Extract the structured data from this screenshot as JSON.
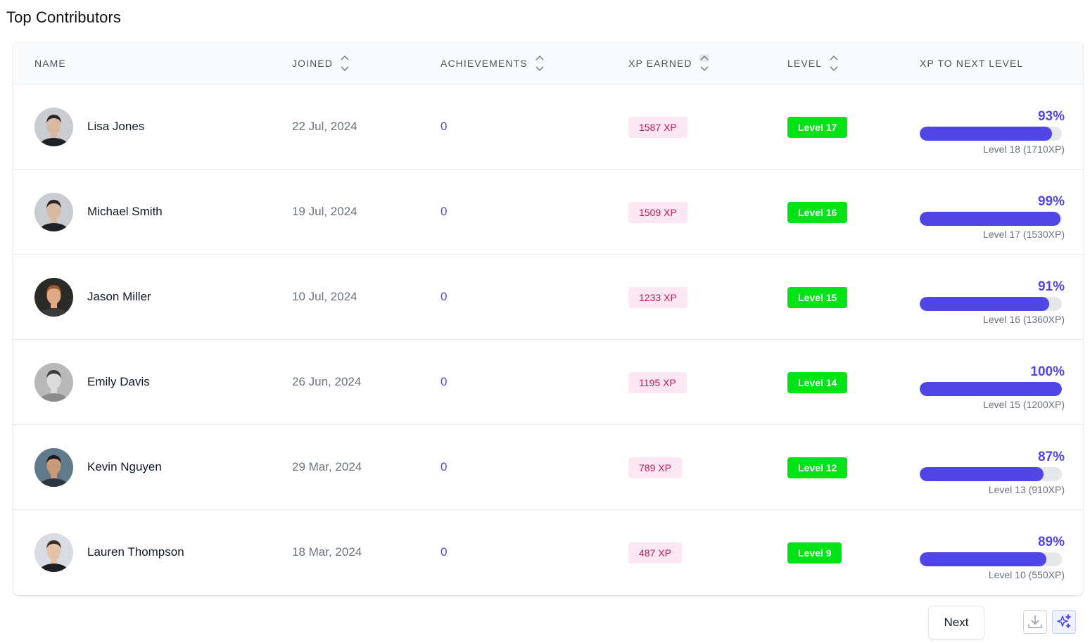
{
  "page": {
    "title": "Top Contributors"
  },
  "table": {
    "columns": {
      "name": "NAME",
      "joined": "JOINED",
      "achievements": "ACHIEVEMENTS",
      "xp_earned": "XP EARNED",
      "level": "LEVEL",
      "xp_to_next": "XP TO NEXT LEVEL"
    },
    "active_sort": "xp_earned",
    "rows": [
      {
        "name": "Lisa Jones",
        "joined": "22 Jul, 2024",
        "achievements": "0",
        "xp": "1587 XP",
        "level": "Level 17",
        "progress_label": "93%",
        "progress": 0.93,
        "next_level": "Level 18 (1710XP)",
        "avatar": {
          "bg": "#c9ccd1",
          "hair": "#2a2522",
          "skin": "#d8b9a2",
          "shirt": "#1f2226"
        }
      },
      {
        "name": "Michael Smith",
        "joined": "19 Jul, 2024",
        "achievements": "0",
        "xp": "1509 XP",
        "level": "Level 16",
        "progress_label": "99%",
        "progress": 0.99,
        "next_level": "Level 17 (1530XP)",
        "avatar": {
          "bg": "#c9ccd1",
          "hair": "#2a2522",
          "skin": "#d8b9a2",
          "shirt": "#1f2226"
        }
      },
      {
        "name": "Jason Miller",
        "joined": "10 Jul, 2024",
        "achievements": "0",
        "xp": "1233 XP",
        "level": "Level 15",
        "progress_label": "91%",
        "progress": 0.91,
        "next_level": "Level 16 (1360XP)",
        "avatar": {
          "bg": "#2c2a26",
          "hair": "#9a5a2c",
          "skin": "#e0a985",
          "shirt": "#3a3a3a"
        }
      },
      {
        "name": "Emily Davis",
        "joined": "26 Jun, 2024",
        "achievements": "0",
        "xp": "1195 XP",
        "level": "Level 14",
        "progress_label": "100%",
        "progress": 1.0,
        "next_level": "Level 15 (1200XP)",
        "avatar": {
          "bg": "#b9b9b9",
          "hair": "#3b3b3b",
          "skin": "#dcdcdc",
          "shirt": "#8c8c8c"
        }
      },
      {
        "name": "Kevin Nguyen",
        "joined": "29 Mar, 2024",
        "achievements": "0",
        "xp": "789 XP",
        "level": "Level 12",
        "progress_label": "87%",
        "progress": 0.87,
        "next_level": "Level 13 (910XP)",
        "avatar": {
          "bg": "#5f7a8a",
          "hair": "#1c1815",
          "skin": "#c89a7a",
          "shirt": "#2b3640"
        }
      },
      {
        "name": "Lauren Thompson",
        "joined": "18 Mar, 2024",
        "achievements": "0",
        "xp": "487 XP",
        "level": "Level 9",
        "progress_label": "89%",
        "progress": 0.89,
        "next_level": "Level 10 (550XP)",
        "avatar": {
          "bg": "#d7dde3",
          "hair": "#3a2e26",
          "skin": "#e4c3a8",
          "shirt": "#1d1f22"
        }
      }
    ]
  },
  "pagination": {
    "next_label": "Next"
  },
  "colors": {
    "accent": "#4f46e5",
    "xp_badge_bg": "#fce7f3",
    "xp_badge_text": "#be185d",
    "level_badge_bg": "#00e316"
  },
  "icons": {
    "download": "download-icon",
    "ai": "sparkles-icon"
  }
}
